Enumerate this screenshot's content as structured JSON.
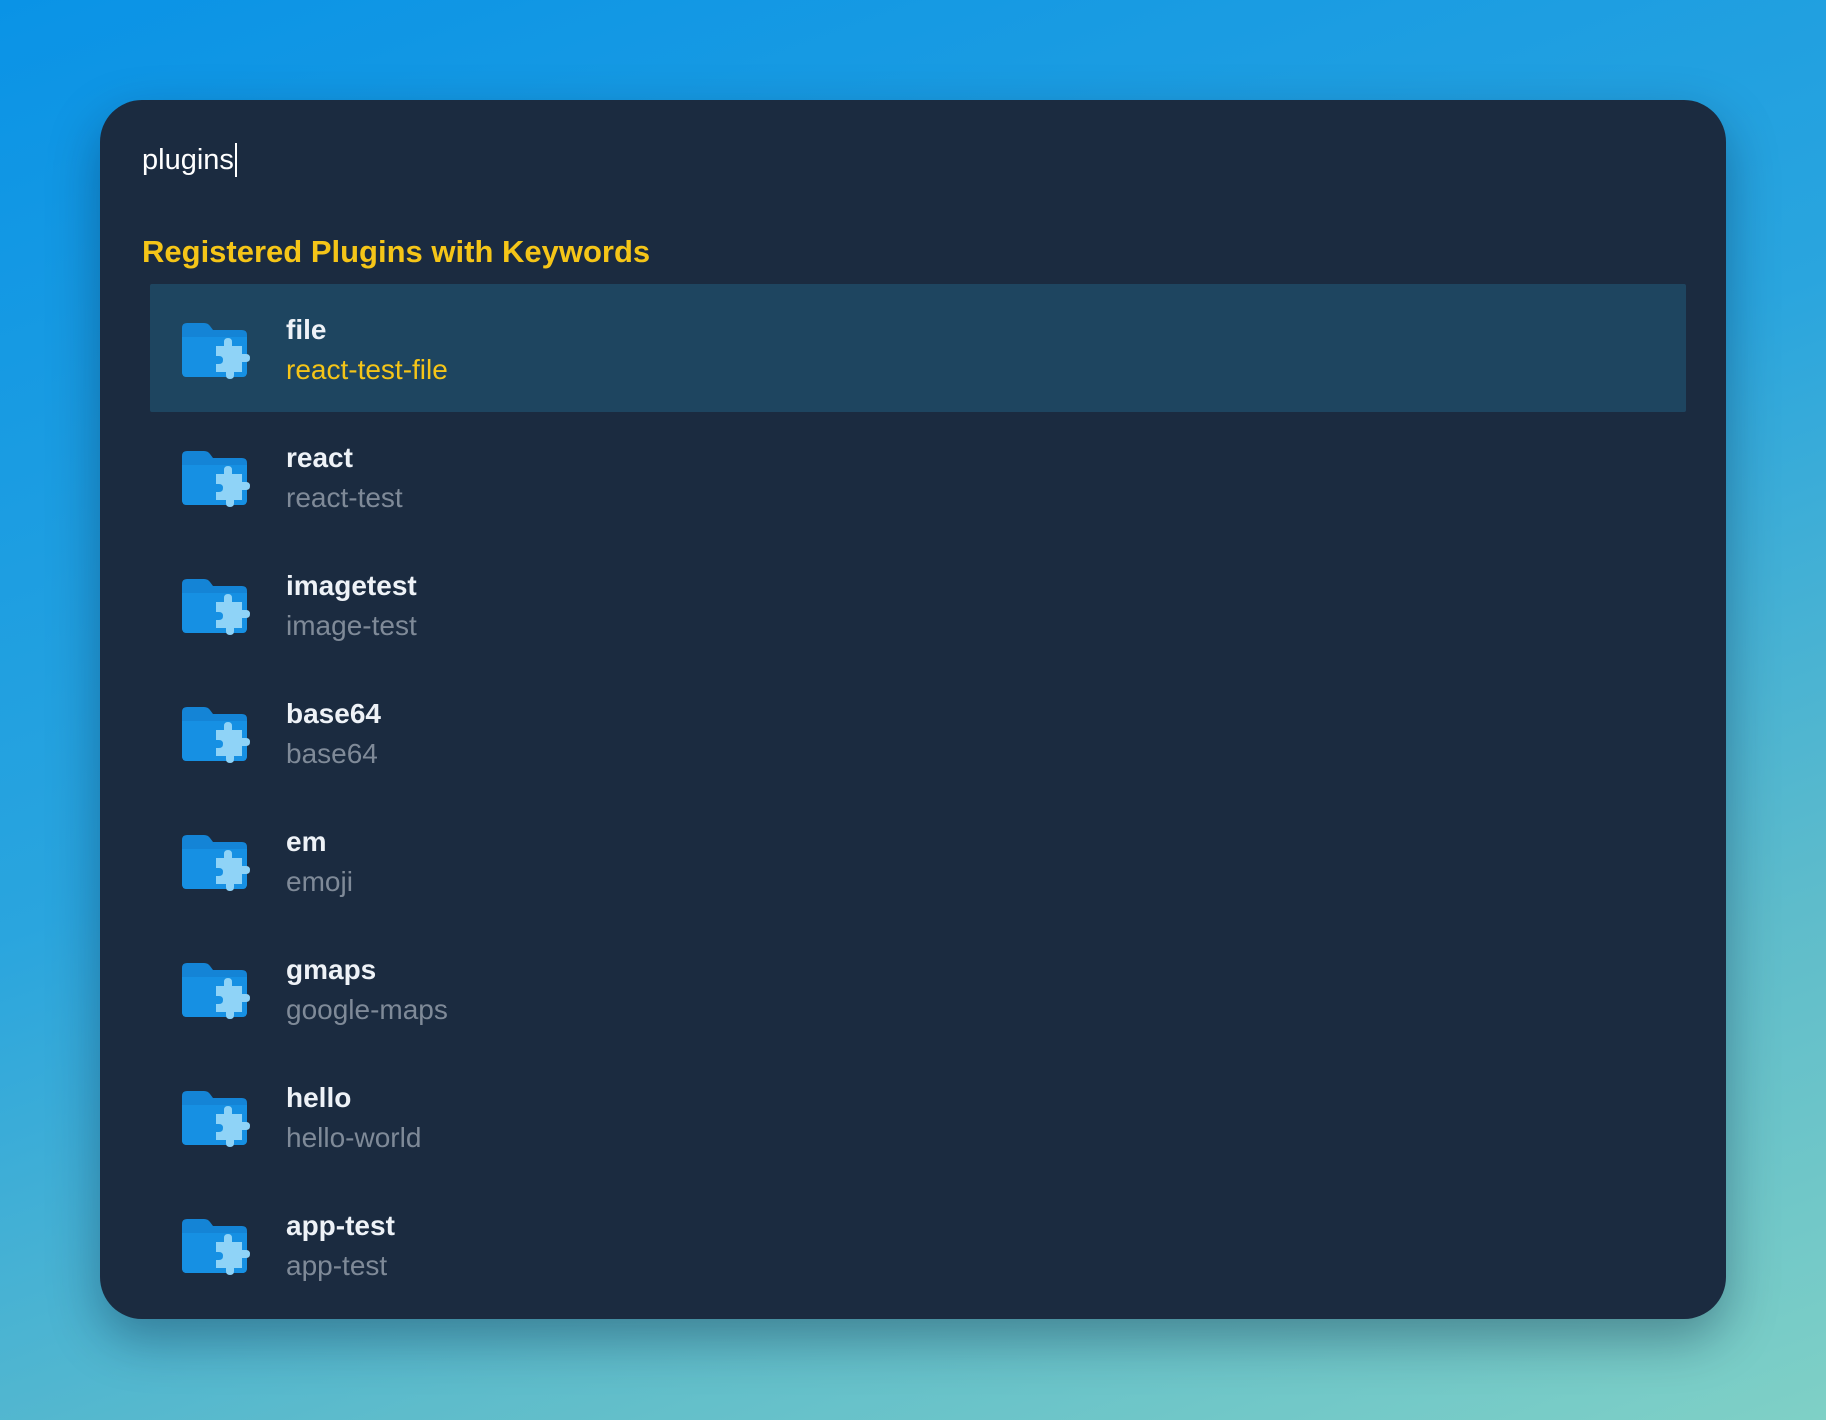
{
  "search": {
    "value": "plugins"
  },
  "section": {
    "title": "Registered Plugins with Keywords"
  },
  "colors": {
    "background_gradient_start": "#0a93e6",
    "background_gradient_end": "#7fd0c6",
    "window_bg": "#1b2b40",
    "selected_row_bg": "#1e4560",
    "accent_yellow": "#f5c518",
    "folder_blue": "#1484d6",
    "puzzle_light_blue": "#8fd3f7"
  },
  "plugins": [
    {
      "name": "file",
      "keyword": "react-test-file",
      "icon": "plugin-folder-icon",
      "selected": true
    },
    {
      "name": "react",
      "keyword": "react-test",
      "icon": "plugin-folder-icon",
      "selected": false
    },
    {
      "name": "imagetest",
      "keyword": "image-test",
      "icon": "plugin-folder-icon",
      "selected": false
    },
    {
      "name": "base64",
      "keyword": "base64",
      "icon": "plugin-folder-icon",
      "selected": false
    },
    {
      "name": "em",
      "keyword": "emoji",
      "icon": "plugin-folder-icon",
      "selected": false
    },
    {
      "name": "gmaps",
      "keyword": "google-maps",
      "icon": "plugin-folder-icon",
      "selected": false
    },
    {
      "name": "hello",
      "keyword": "hello-world",
      "icon": "plugin-folder-icon",
      "selected": false
    },
    {
      "name": "app-test",
      "keyword": "app-test",
      "icon": "plugin-folder-icon",
      "selected": false
    }
  ]
}
